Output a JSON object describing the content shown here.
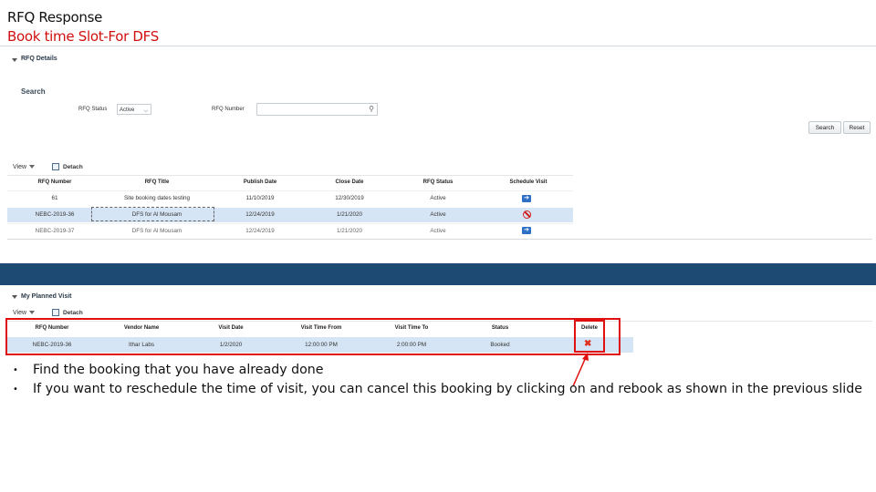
{
  "slide": {
    "title": "RFQ Response",
    "subtitle": "Book time Slot-For DFS"
  },
  "rfq_details": {
    "header": "RFQ Details",
    "search_header": "Search",
    "status_label": "RFQ Status",
    "status_value": "Active",
    "number_label": "RFQ Number",
    "number_value": "",
    "search_button": "Search",
    "reset_button": "Reset",
    "view_label": "View",
    "detach_label": "Detach",
    "columns": [
      "RFQ Number",
      "RFQ Title",
      "Publish Date",
      "Close Date",
      "RFQ Status",
      "Schedule Visit"
    ],
    "rows": [
      {
        "number": "61",
        "title": "Site booking dates testing",
        "publish": "11/10/2019",
        "close": "12/30/2019",
        "status": "Active",
        "action": "arrow-right-icon"
      },
      {
        "number": "NEBC-2019-36",
        "title": "DFS for Al Mousam",
        "publish": "12/24/2019",
        "close": "1/21/2020",
        "status": "Active",
        "action": "no-entry-icon"
      },
      {
        "number": "NEBC-2019-37",
        "title": "DFS for Al Mousam",
        "publish": "12/24/2019",
        "close": "1/21/2020",
        "status": "Active",
        "action": "arrow-right-icon"
      }
    ]
  },
  "planned_visit": {
    "header": "My Planned Visit",
    "view_label": "View",
    "detach_label": "Detach",
    "columns": [
      "RFQ Number",
      "Vendor Name",
      "Visit Date",
      "Visit Time From",
      "Visit Time To",
      "Status",
      "Delete"
    ],
    "rows": [
      {
        "number": "NEBC-2019-36",
        "vendor": "Ithar Labs",
        "date": "1/2/2020",
        "from": "12:00:00 PM",
        "to": "2:00:00 PM",
        "status": "Booked",
        "delete": "✖"
      }
    ]
  },
  "notes": [
    "Find the booking that you have already done",
    "If you want to reschedule the time of visit, you can cancel this booking by clicking on  and rebook as shown in the previous slide"
  ],
  "colors": {
    "highlight": "#e01010",
    "selected_row": "#d6e5f5",
    "band": "#1d4a72"
  }
}
